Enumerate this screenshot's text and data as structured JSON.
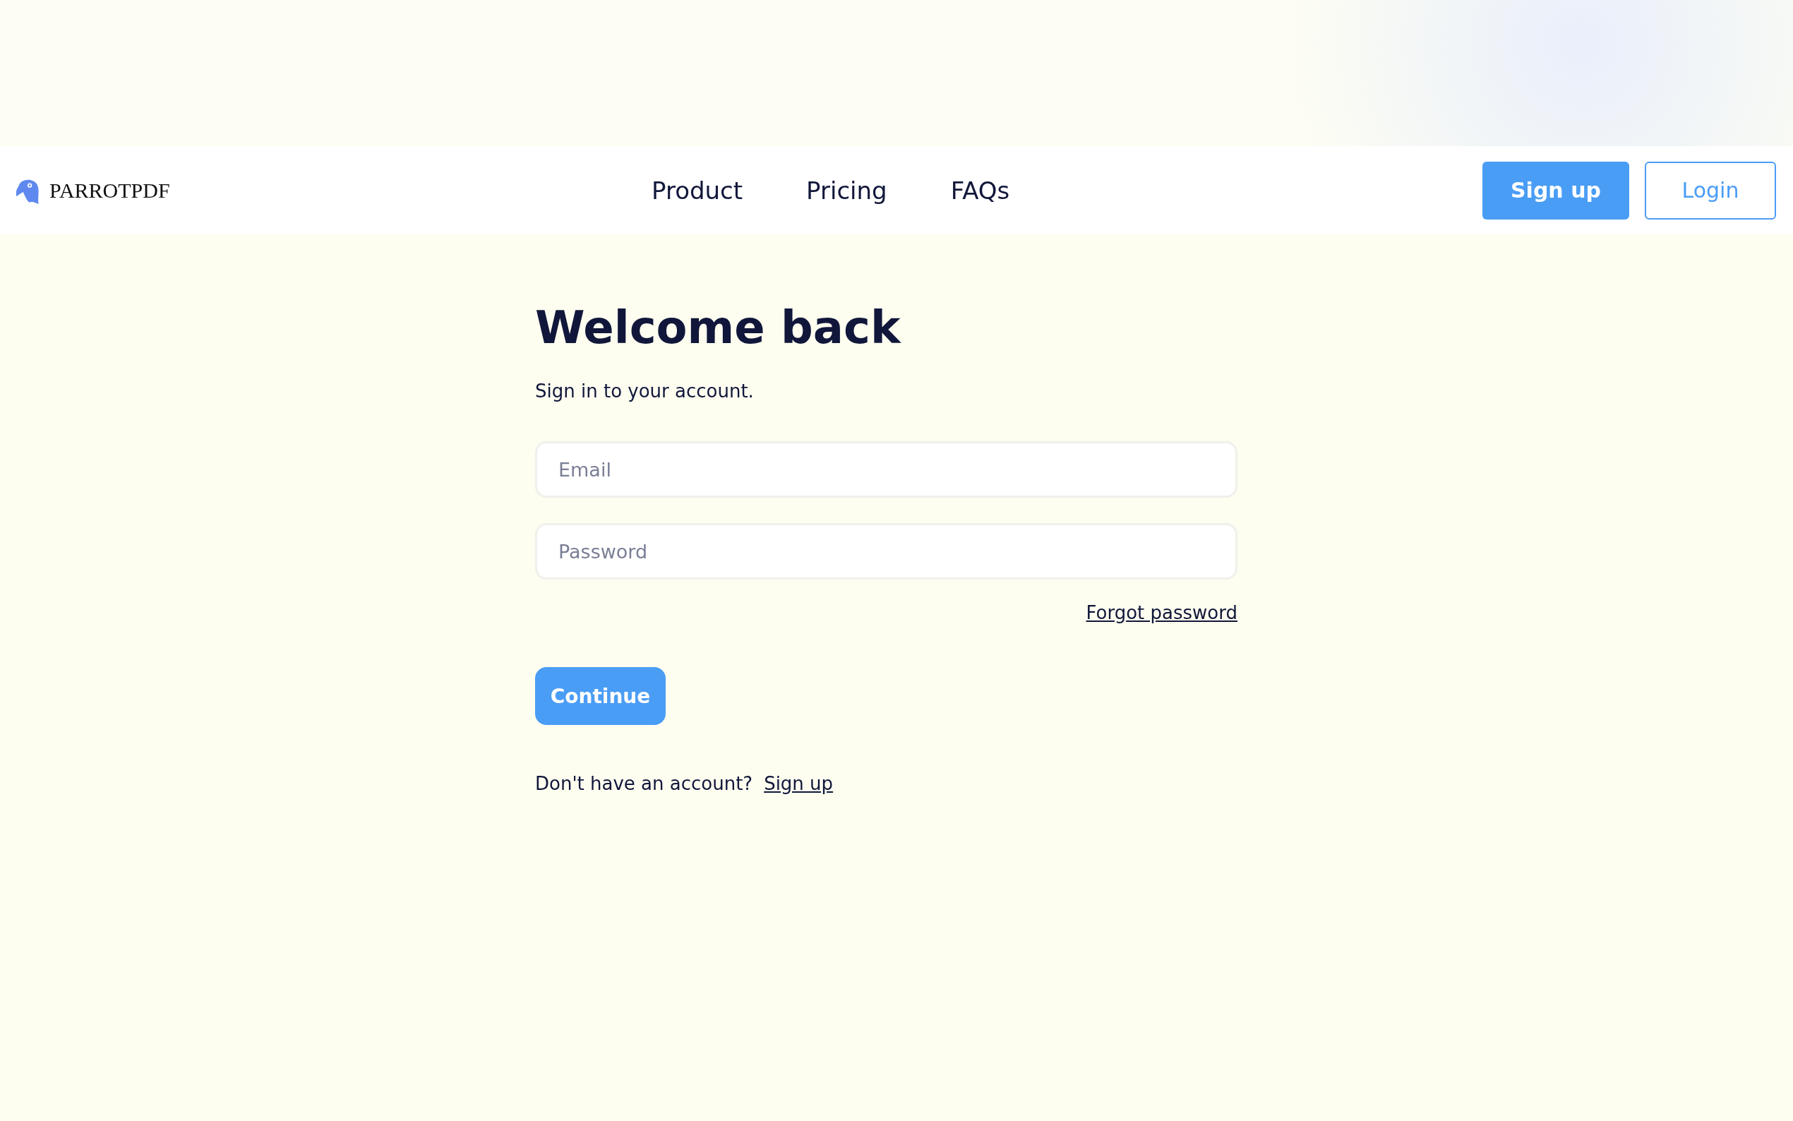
{
  "header": {
    "logo": "PARROTPDF",
    "nav": [
      "Product",
      "Pricing",
      "FAQs"
    ],
    "signup": "Sign up",
    "login": "Login"
  },
  "form": {
    "title": "Welcome back",
    "subtitle": "Sign in to your account.",
    "fields": [
      {
        "placeholder": "Email"
      },
      {
        "placeholder": "Password"
      }
    ],
    "forgot": "Forgot password",
    "submit": "Continue",
    "footer_text": "Don't have an account?",
    "footer_link": "Sign up"
  }
}
